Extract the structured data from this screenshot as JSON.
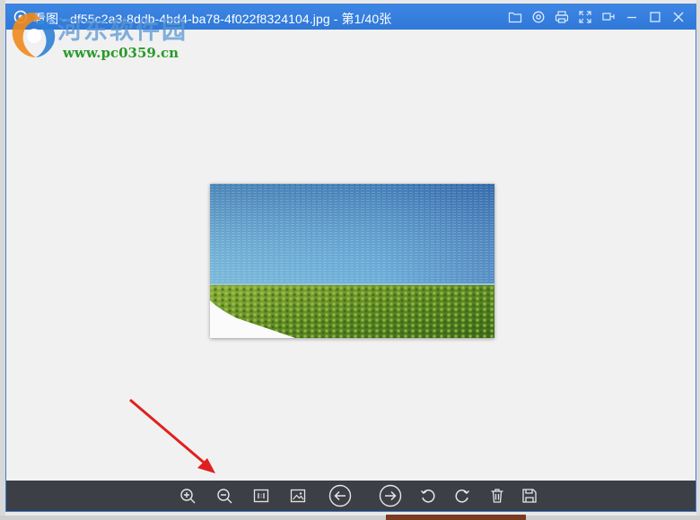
{
  "window": {
    "title": "2345看图王 - df55c2a3-8ddb-4bd4-ba78-4f022f8324104.jpg - 第1/40张",
    "title_visible": "看图 - df55c2a3-8ddb-4bd4-ba78-4f022f8324104.jpg - 第1/40张",
    "app_icon": "app-logo-icon",
    "controls": [
      "folder-icon",
      "settings-icon",
      "print-icon",
      "fullscreen-icon",
      "pin-icon",
      "minimize-icon",
      "maximize-icon",
      "close-icon"
    ]
  },
  "watermark": {
    "title": "河东软件园",
    "url": "www.pc0359.cn"
  },
  "toolbar": {
    "tools": [
      "zoom-in-icon",
      "zoom-out-icon",
      "actual-size-icon",
      "fit-image-icon",
      "previous-icon",
      "next-icon",
      "rotate-left-icon",
      "rotate-right-icon",
      "delete-icon",
      "save-icon"
    ]
  },
  "colors": {
    "titlebar": "#3078d8",
    "viewer_bg": "#f1f1f1",
    "toolbar_bg": "#3c3f45",
    "annotation_arrow": "#e02020"
  }
}
